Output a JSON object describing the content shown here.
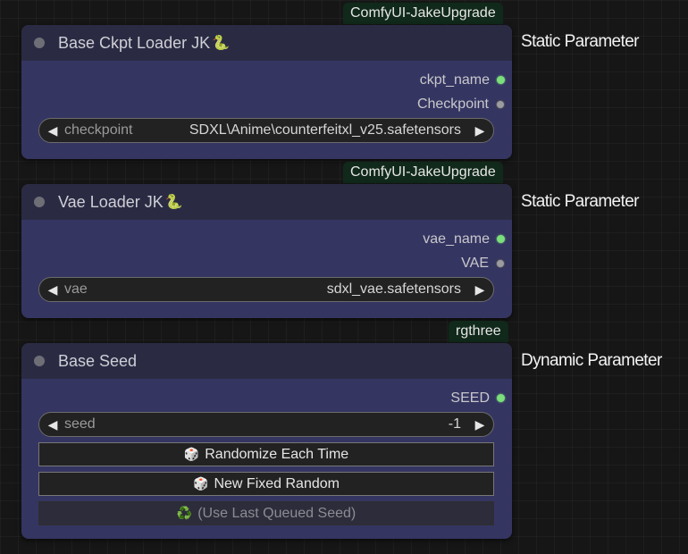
{
  "nodes": [
    {
      "badge": "ComfyUI-JakeUpgrade",
      "title": "Base Ckpt Loader JK",
      "title_emoji": "🐍",
      "side_label": "Static Parameter",
      "outputs": [
        {
          "label": "ckpt_name",
          "color": "#7be07b"
        },
        {
          "label": "Checkpoint",
          "color": "#9b9ba3"
        }
      ],
      "widget": {
        "label": "checkpoint",
        "value": "SDXL\\Anime\\counterfeitxl_v25.safetensors"
      }
    },
    {
      "badge": "ComfyUI-JakeUpgrade",
      "title": "Vae Loader JK",
      "title_emoji": "🐍",
      "side_label": "Static Parameter",
      "outputs": [
        {
          "label": "vae_name",
          "color": "#7be07b"
        },
        {
          "label": "VAE",
          "color": "#9b9ba3"
        }
      ],
      "widget": {
        "label": "vae",
        "value": "sdxl_vae.safetensors"
      }
    },
    {
      "badge": "rgthree",
      "title": "Base Seed",
      "side_label": "Dynamic Parameter",
      "outputs": [
        {
          "label": "SEED",
          "color": "#7be07b"
        }
      ],
      "widget": {
        "label": "seed",
        "value": "-1"
      },
      "buttons": [
        {
          "icon": "🎲",
          "label": "Randomize Each Time"
        },
        {
          "icon": "🎲",
          "label": "New Fixed Random"
        },
        {
          "icon": "♻️",
          "label": "(Use Last Queued Seed)"
        }
      ]
    }
  ],
  "arrows": {
    "left": "◀",
    "right": "▶"
  }
}
